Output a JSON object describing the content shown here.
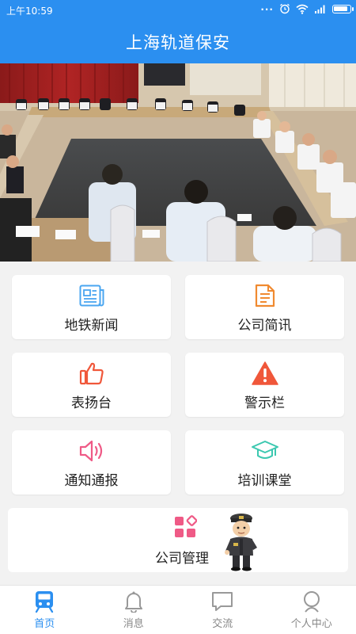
{
  "status": {
    "time": "上午10:59",
    "dots": "...",
    "battery_level": 0.9
  },
  "app": {
    "title": "上海轨道保安"
  },
  "grid": [
    {
      "label": "地铁新闻",
      "icon": "newspaper-icon",
      "color": "#4aa6f0"
    },
    {
      "label": "公司简讯",
      "icon": "document-icon",
      "color": "#f08a30"
    },
    {
      "label": "表扬台",
      "icon": "thumbs-up-icon",
      "color": "#f0573a"
    },
    {
      "label": "警示栏",
      "icon": "warning-icon",
      "color": "#f0573a"
    },
    {
      "label": "通知通报",
      "icon": "speaker-icon",
      "color": "#ef5a86"
    },
    {
      "label": "培训课堂",
      "icon": "graduation-cap-icon",
      "color": "#3cc8b0"
    }
  ],
  "company": {
    "label": "公司管理",
    "icon": "apps-grid-icon",
    "color": "#ef5a86"
  },
  "tabs": [
    {
      "label": "首页",
      "icon": "metro-train-icon",
      "active": true
    },
    {
      "label": "消息",
      "icon": "bell-icon",
      "active": false
    },
    {
      "label": "交流",
      "icon": "chat-bubble-icon",
      "active": false
    },
    {
      "label": "个人中心",
      "icon": "person-icon",
      "active": false
    }
  ],
  "colors": {
    "primary": "#2b8ff0",
    "inactive_tab": "#999999"
  }
}
